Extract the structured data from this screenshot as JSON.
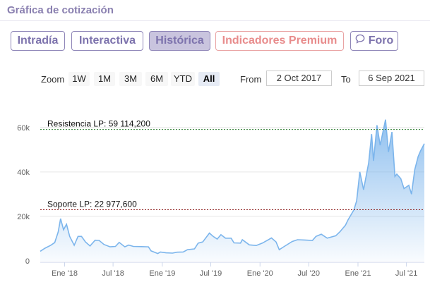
{
  "header": {
    "title": "Gráfica de cotización"
  },
  "tabs": [
    {
      "label": "Intradía",
      "state": "normal"
    },
    {
      "label": "Interactiva",
      "state": "normal"
    },
    {
      "label": "Histórica",
      "state": "active"
    },
    {
      "label": "Indicadores Premium",
      "state": "premium"
    },
    {
      "label": "Foro",
      "state": "normal",
      "icon": "chat-bubble-icon"
    }
  ],
  "zoom": {
    "label": "Zoom",
    "buttons": [
      "1W",
      "1M",
      "3M",
      "6M",
      "YTD",
      "All"
    ],
    "selected": "All",
    "from_label": "From",
    "from_value": "2 Oct 2017",
    "to_label": "To",
    "to_value": "6 Sep 2021"
  },
  "colors": {
    "accent": "#8f86b8",
    "active_tab": "#c9c4de",
    "premium": "#e88c8c",
    "series_line": "#7cb5ec",
    "resistance_line": "#2e7d32",
    "support_line": "#8b1a1a"
  },
  "chart_data": {
    "type": "area",
    "x_start": "2017-10-02",
    "x_end": "2021-09-06",
    "xticks": [
      "Ene '18",
      "Jul '18",
      "Ene '19",
      "Jul '19",
      "Ene '20",
      "Jul '20",
      "Ene '21",
      "Jul '21"
    ],
    "ylim": [
      0,
      65000
    ],
    "yticks": [
      0,
      20000,
      40000,
      60000
    ],
    "ytick_labels": [
      "0",
      "20k",
      "40k",
      "60k"
    ],
    "annotations": [
      {
        "text": "Resistencia LP: 59 114,200",
        "y": 59114.2
      },
      {
        "text": "Soporte LP: 22 977,600",
        "y": 22977.6
      }
    ],
    "series": [
      {
        "points": [
          [
            "2017-10-02",
            4300
          ],
          [
            "2017-10-20",
            5700
          ],
          [
            "2017-11-10",
            7000
          ],
          [
            "2017-11-25",
            8200
          ],
          [
            "2017-12-08",
            13000
          ],
          [
            "2017-12-17",
            19000
          ],
          [
            "2017-12-28",
            14000
          ],
          [
            "2018-01-08",
            16500
          ],
          [
            "2018-01-20",
            11000
          ],
          [
            "2018-02-06",
            7000
          ],
          [
            "2018-02-20",
            11000
          ],
          [
            "2018-03-05",
            11000
          ],
          [
            "2018-03-20",
            8500
          ],
          [
            "2018-04-06",
            6700
          ],
          [
            "2018-04-25",
            9300
          ],
          [
            "2018-05-10",
            9200
          ],
          [
            "2018-05-28",
            7400
          ],
          [
            "2018-06-20",
            6300
          ],
          [
            "2018-07-10",
            6500
          ],
          [
            "2018-07-24",
            8300
          ],
          [
            "2018-08-14",
            6300
          ],
          [
            "2018-08-28",
            7100
          ],
          [
            "2018-09-15",
            6500
          ],
          [
            "2018-10-15",
            6400
          ],
          [
            "2018-11-10",
            6300
          ],
          [
            "2018-11-20",
            4500
          ],
          [
            "2018-12-15",
            3300
          ],
          [
            "2018-12-25",
            4000
          ],
          [
            "2019-01-15",
            3600
          ],
          [
            "2019-02-08",
            3500
          ],
          [
            "2019-02-25",
            3900
          ],
          [
            "2019-03-20",
            4000
          ],
          [
            "2019-04-05",
            5000
          ],
          [
            "2019-05-01",
            5400
          ],
          [
            "2019-05-15",
            8000
          ],
          [
            "2019-06-01",
            8500
          ],
          [
            "2019-06-26",
            12500
          ],
          [
            "2019-07-10",
            11000
          ],
          [
            "2019-07-25",
            9800
          ],
          [
            "2019-08-08",
            11800
          ],
          [
            "2019-08-25",
            10200
          ],
          [
            "2019-09-15",
            10200
          ],
          [
            "2019-09-26",
            8100
          ],
          [
            "2019-10-20",
            8000
          ],
          [
            "2019-10-27",
            9500
          ],
          [
            "2019-11-22",
            7200
          ],
          [
            "2019-12-18",
            6900
          ],
          [
            "2020-01-10",
            8000
          ],
          [
            "2020-02-13",
            10300
          ],
          [
            "2020-03-01",
            8500
          ],
          [
            "2020-03-13",
            5000
          ],
          [
            "2020-04-01",
            6500
          ],
          [
            "2020-04-30",
            8700
          ],
          [
            "2020-05-20",
            9500
          ],
          [
            "2020-06-15",
            9400
          ],
          [
            "2020-07-15",
            9200
          ],
          [
            "2020-07-28",
            11000
          ],
          [
            "2020-08-17",
            12000
          ],
          [
            "2020-09-08",
            10200
          ],
          [
            "2020-10-10",
            11300
          ],
          [
            "2020-10-25",
            13000
          ],
          [
            "2020-11-15",
            16000
          ],
          [
            "2020-11-25",
            18500
          ],
          [
            "2020-12-17",
            23000
          ],
          [
            "2020-12-27",
            27000
          ],
          [
            "2021-01-08",
            40000
          ],
          [
            "2021-01-22",
            32000
          ],
          [
            "2021-02-10",
            44000
          ],
          [
            "2021-02-21",
            57000
          ],
          [
            "2021-02-28",
            45000
          ],
          [
            "2021-03-13",
            61000
          ],
          [
            "2021-03-25",
            52000
          ],
          [
            "2021-04-14",
            63500
          ],
          [
            "2021-04-25",
            49000
          ],
          [
            "2021-05-08",
            58000
          ],
          [
            "2021-05-19",
            38000
          ],
          [
            "2021-05-26",
            39000
          ],
          [
            "2021-06-10",
            37000
          ],
          [
            "2021-06-22",
            32500
          ],
          [
            "2021-07-10",
            34000
          ],
          [
            "2021-07-20",
            30000
          ],
          [
            "2021-08-01",
            41000
          ],
          [
            "2021-08-14",
            47000
          ],
          [
            "2021-08-23",
            49500
          ],
          [
            "2021-09-06",
            52700
          ]
        ]
      }
    ]
  }
}
